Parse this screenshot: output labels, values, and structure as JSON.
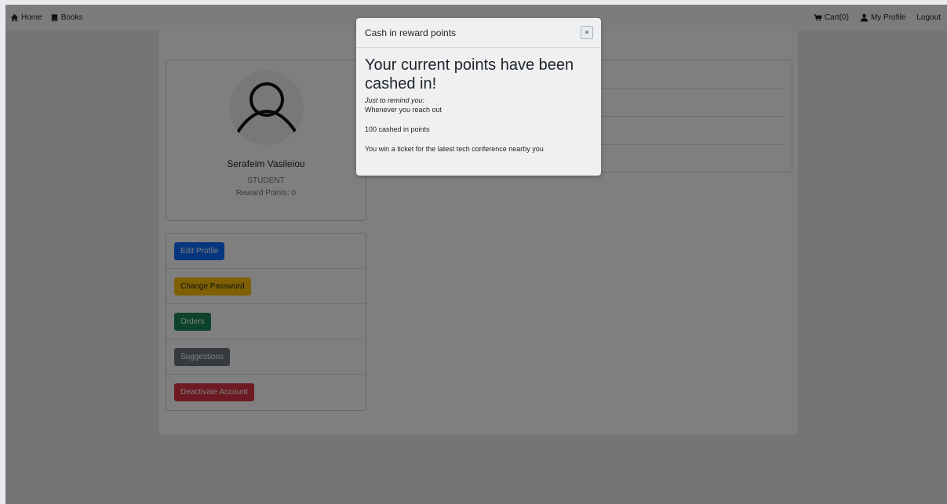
{
  "navbar": {
    "home_label": "Home",
    "books_label": "Books",
    "cart_label": "Cart(0)",
    "profile_label": "My Profile",
    "logout_label": "Logout"
  },
  "profile": {
    "name": "Serafeim Vasileiou",
    "role": "STUDENT",
    "reward_points": "Reward Points: 0"
  },
  "actions": {
    "edit_profile": "Edit Profile",
    "change_password": "Change Password",
    "orders": "Orders",
    "suggestions": "Suggestions",
    "deactivate": "Deactivate Account"
  },
  "modal": {
    "title": "Cash in reward points",
    "close": "×",
    "heading": "Your current points have been cashed in!",
    "remind": "Just to remind you:",
    "line1": "Whenever you reach out",
    "line2": "100 cashed in points",
    "line3": "You win a ticket for the latest tech conference nearby you"
  },
  "colors": {
    "primary": "#0d6efd",
    "warning": "#ffc107",
    "success": "#198754",
    "secondary": "#6c757d",
    "danger": "#dc3545"
  },
  "icons": {
    "home": "home-icon",
    "books": "book-icon",
    "cart": "cart-icon",
    "profile": "user-icon",
    "avatar": "person-outline-icon"
  }
}
